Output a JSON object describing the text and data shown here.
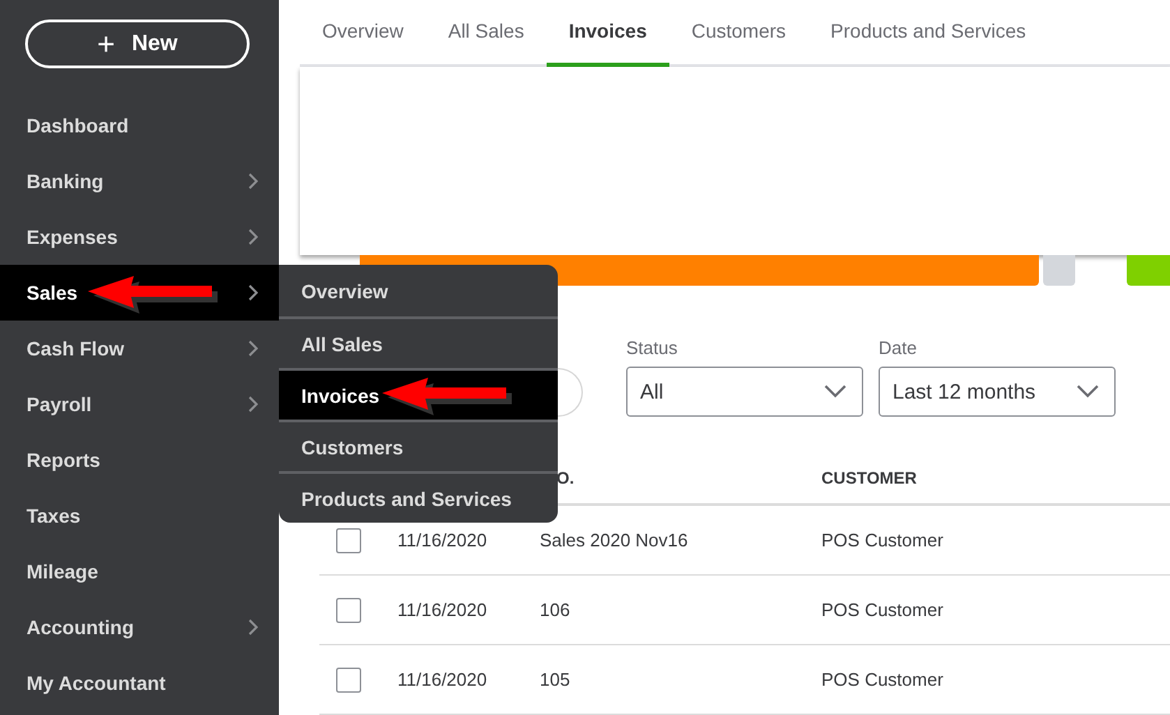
{
  "new_button": {
    "label": "New",
    "icon": "+"
  },
  "sidebar": {
    "items": [
      {
        "label": "Dashboard",
        "has_submenu": false,
        "selected": false
      },
      {
        "label": "Banking",
        "has_submenu": true,
        "selected": false
      },
      {
        "label": "Expenses",
        "has_submenu": true,
        "selected": false
      },
      {
        "label": "Sales",
        "has_submenu": true,
        "selected": true
      },
      {
        "label": "Cash Flow",
        "has_submenu": true,
        "selected": false
      },
      {
        "label": "Payroll",
        "has_submenu": true,
        "selected": false
      },
      {
        "label": "Reports",
        "has_submenu": false,
        "selected": false
      },
      {
        "label": "Taxes",
        "has_submenu": false,
        "selected": false
      },
      {
        "label": "Mileage",
        "has_submenu": false,
        "selected": false
      },
      {
        "label": "Accounting",
        "has_submenu": true,
        "selected": false
      },
      {
        "label": "My Accountant",
        "has_submenu": false,
        "selected": false
      }
    ]
  },
  "tabs": [
    {
      "label": "Overview",
      "selected": false
    },
    {
      "label": "All Sales",
      "selected": false
    },
    {
      "label": "Invoices",
      "selected": true
    },
    {
      "label": "Customers",
      "selected": false
    },
    {
      "label": "Products and Services",
      "selected": false
    }
  ],
  "money_bar": {
    "segments": [
      {
        "color": "#ff8000"
      },
      {
        "color": "#d4d7dc"
      },
      {
        "color": "#7fd000"
      }
    ]
  },
  "filters": [
    {
      "label": "Status",
      "value": "All"
    },
    {
      "label": "Date",
      "value": "Last 12 months"
    }
  ],
  "table": {
    "columns": [
      "O.",
      "CUSTOMER"
    ],
    "rows": [
      {
        "checked": false,
        "date": "11/16/2020",
        "no": "Sales 2020 Nov16",
        "customer": "POS Customer"
      },
      {
        "checked": false,
        "date": "11/16/2020",
        "no": "106",
        "customer": "POS Customer"
      },
      {
        "checked": false,
        "date": "11/16/2020",
        "no": "105",
        "customer": "POS Customer"
      }
    ]
  },
  "submenu": {
    "items": [
      {
        "label": "Overview",
        "selected": false
      },
      {
        "label": "All Sales",
        "selected": false
      },
      {
        "label": "Invoices",
        "selected": true
      },
      {
        "label": "Customers",
        "selected": false
      },
      {
        "label": "Products and Services",
        "selected": false
      }
    ]
  }
}
